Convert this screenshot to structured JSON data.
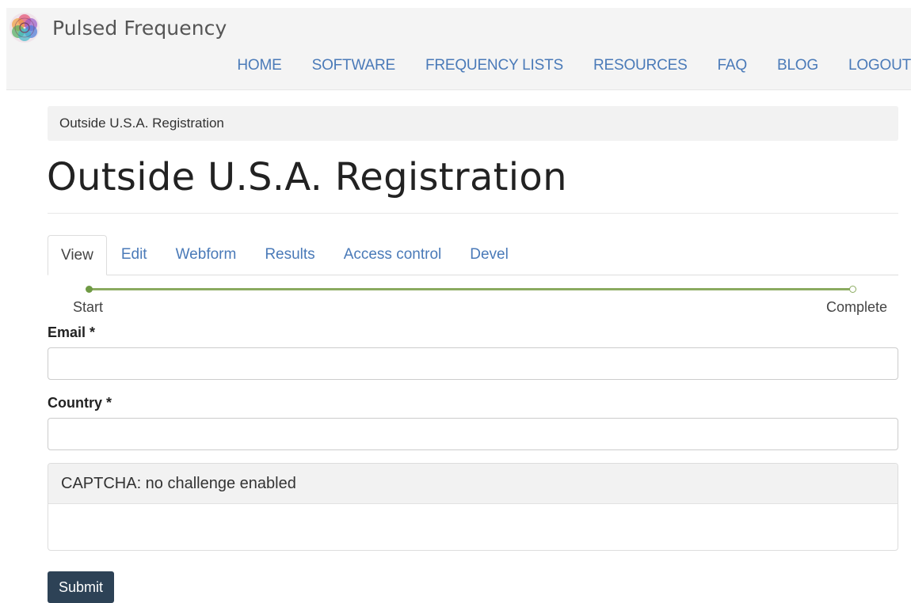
{
  "header": {
    "site_name": "Pulsed Frequency",
    "logo_icon": "flower-of-life-logo-icon",
    "nav": [
      "HOME",
      "SOFTWARE",
      "FREQUENCY LISTS",
      "RESOURCES",
      "FAQ",
      "BLOG",
      "LOGOUT"
    ]
  },
  "breadcrumb": "Outside U.S.A. Registration",
  "page_title": "Outside U.S.A. Registration",
  "tabs": [
    "View",
    "Edit",
    "Webform",
    "Results",
    "Access control",
    "Devel"
  ],
  "active_tab": "View",
  "progress": {
    "start_label": "Start",
    "end_label": "Complete",
    "color": "#8bab60"
  },
  "form": {
    "email_label": "Email *",
    "email_value": "",
    "country_label": "Country *",
    "country_value": "",
    "captcha_title": "CAPTCHA: no challenge enabled",
    "submit_label": "Submit"
  },
  "colors": {
    "link": "#4a7ab8",
    "header_bg": "#f4f4f4",
    "button_bg": "#2d4256"
  }
}
